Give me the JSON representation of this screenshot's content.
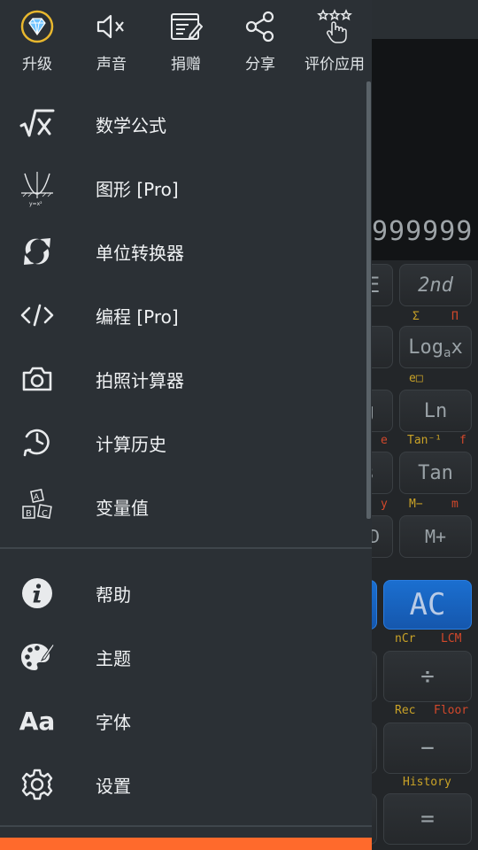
{
  "top_actions": [
    {
      "label": "升级",
      "icon": "diamond-icon"
    },
    {
      "label": "声音",
      "icon": "sound-muted-icon"
    },
    {
      "label": "捐赠",
      "icon": "donate-note-icon"
    },
    {
      "label": "分享",
      "icon": "share-icon"
    },
    {
      "label": "评价应用",
      "icon": "rate-stars-icon"
    }
  ],
  "menu": {
    "math_formulas": "数学公式",
    "graph": "图形 [Pro]",
    "unit_converter": "单位转换器",
    "programming": "编程 [Pro]",
    "photo_calculator": "拍照计算器",
    "history": "计算历史",
    "variables": "变量值",
    "help": "帮助",
    "theme": "主题",
    "font": "字体",
    "settings": "设置"
  },
  "icon_glyphs": {
    "graph_caption": "y=x²",
    "blocks": [
      "A",
      "B",
      "C"
    ],
    "font_icon": "Aa"
  },
  "calculator": {
    "display": "999999",
    "keys": {
      "k_e": "E",
      "second": "2nd",
      "loga": "Log",
      "loga_sub": "a",
      "loga_x": "x",
      "g": "g",
      "ln": "Ln",
      "s": "s",
      "tan": "Tan",
      "o": "D",
      "mplus": "M+",
      "ac": "AC",
      "divide": "÷",
      "minus": "−",
      "equals": "="
    },
    "labels": {
      "sigma": "Σ",
      "pi": "Π",
      "epow": "e□",
      "e": "e",
      "tan_inv": "Tan⁻¹",
      "f": "f",
      "y": "y",
      "m_minus": "M−",
      "m": "m",
      "ncr": "nCr",
      "lcm": "LCM",
      "rec": "Rec",
      "floor": "Floor",
      "history": "History"
    }
  },
  "colors": {
    "drawer_bg": "#2b3035",
    "accent_orange": "#ff6a2c",
    "ac_blue": "#1b6fd0",
    "label_yellow": "#c9a227",
    "label_red": "#d2482b"
  }
}
